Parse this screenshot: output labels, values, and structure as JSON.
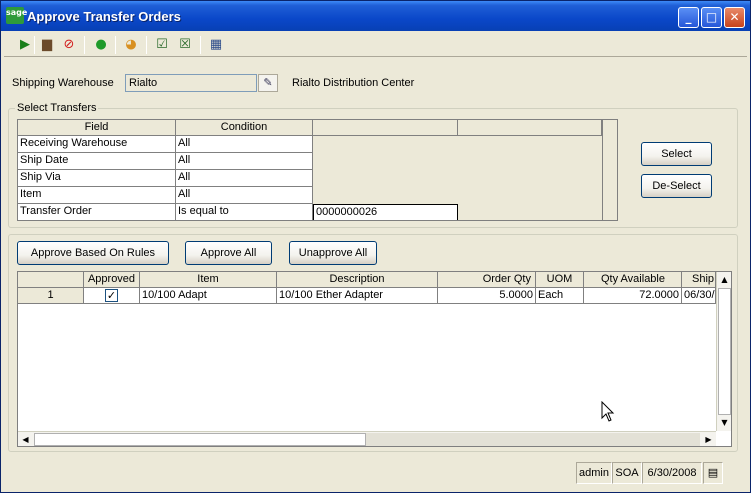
{
  "window": {
    "logo": "sage",
    "title": "Approve Transfer Orders",
    "controls": [
      "minimize-icon",
      "maximize-icon",
      "close-icon"
    ]
  },
  "toolbar": {
    "icons": [
      "run-arrow-icon",
      "printer-icon",
      "stop-icon",
      "help-icon",
      "chart-icon",
      "select-check-icon",
      "deselect-check-icon",
      "grid-icon"
    ]
  },
  "shipping": {
    "label": "Shipping Warehouse",
    "value": "Rialto",
    "description": "Rialto Distribution Center"
  },
  "select_transfers": {
    "group_label": "Select Transfers",
    "headers": [
      "Field",
      "Condition"
    ],
    "rows": [
      {
        "field": "Receiving Warehouse",
        "condition": "All",
        "value": ""
      },
      {
        "field": "Ship Date",
        "condition": "All",
        "value": ""
      },
      {
        "field": "Ship Via",
        "condition": "All",
        "value": ""
      },
      {
        "field": "Item",
        "condition": "All",
        "value": ""
      },
      {
        "field": "Transfer Order",
        "condition": "Is equal to",
        "value": "0000000026"
      }
    ],
    "select_button": "Select",
    "deselect_button": "De-Select"
  },
  "actions": {
    "approve_rules": "Approve Based On Rules",
    "approve_all": "Approve All",
    "unapprove_all": "Unapprove All"
  },
  "orders": {
    "headers": [
      "Approved",
      "Item",
      "Description",
      "Order Qty",
      "UOM",
      "Qty Available",
      "Ship"
    ],
    "rows": [
      {
        "row": "1",
        "approved": true,
        "item": "10/100 Adapt",
        "description": "10/100 Ether Adapter",
        "order_qty": "5.0000",
        "uom": "Each",
        "qty_available": "72.0000",
        "ship": "06/30/"
      }
    ]
  },
  "status": {
    "user": "admin",
    "company": "SOA",
    "date": "6/30/2008"
  }
}
